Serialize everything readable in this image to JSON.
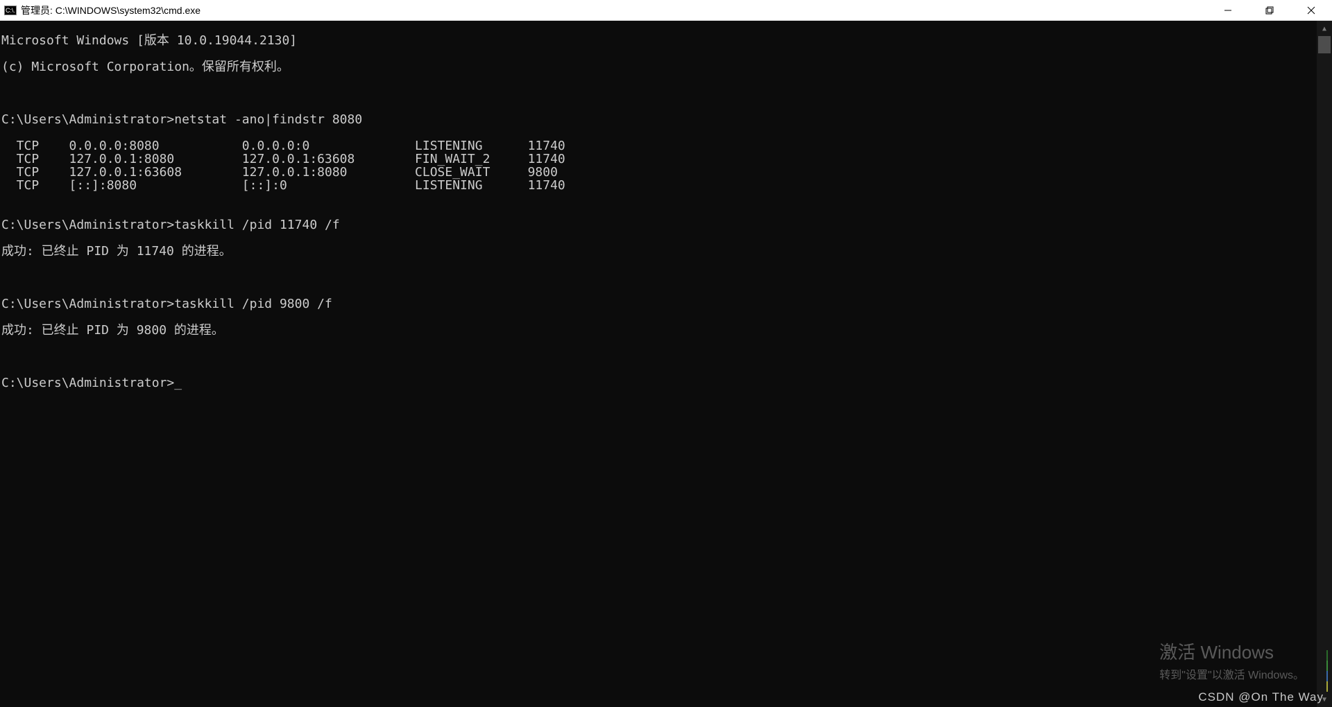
{
  "titlebar": {
    "icon_label": "C:\\.",
    "title": "管理员: C:\\WINDOWS\\system32\\cmd.exe"
  },
  "console": {
    "header1": "Microsoft Windows [版本 10.0.19044.2130]",
    "header2": "(c) Microsoft Corporation。保留所有权利。",
    "prompt_path": "C:\\Users\\Administrator>",
    "cmd1": "netstat -ano|findstr 8080",
    "netstat_rows": [
      {
        "proto": "TCP",
        "local": "0.0.0.0:8080",
        "remote": "0.0.0.0:0",
        "state": "LISTENING",
        "pid": "11740"
      },
      {
        "proto": "TCP",
        "local": "127.0.0.1:8080",
        "remote": "127.0.0.1:63608",
        "state": "FIN_WAIT_2",
        "pid": "11740"
      },
      {
        "proto": "TCP",
        "local": "127.0.0.1:63608",
        "remote": "127.0.0.1:8080",
        "state": "CLOSE_WAIT",
        "pid": "9800"
      },
      {
        "proto": "TCP",
        "local": "[::]:8080",
        "remote": "[::]:0",
        "state": "LISTENING",
        "pid": "11740"
      }
    ],
    "cmd2": "taskkill /pid 11740 /f",
    "result2": "成功: 已终止 PID 为 11740 的进程。",
    "cmd3": "taskkill /pid 9800 /f",
    "result3": "成功: 已终止 PID 为 9800 的进程。"
  },
  "watermark": {
    "title": "激活 Windows",
    "sub": "转到\"设置\"以激活 Windows。"
  },
  "csdn": "CSDN @On   The   Way"
}
